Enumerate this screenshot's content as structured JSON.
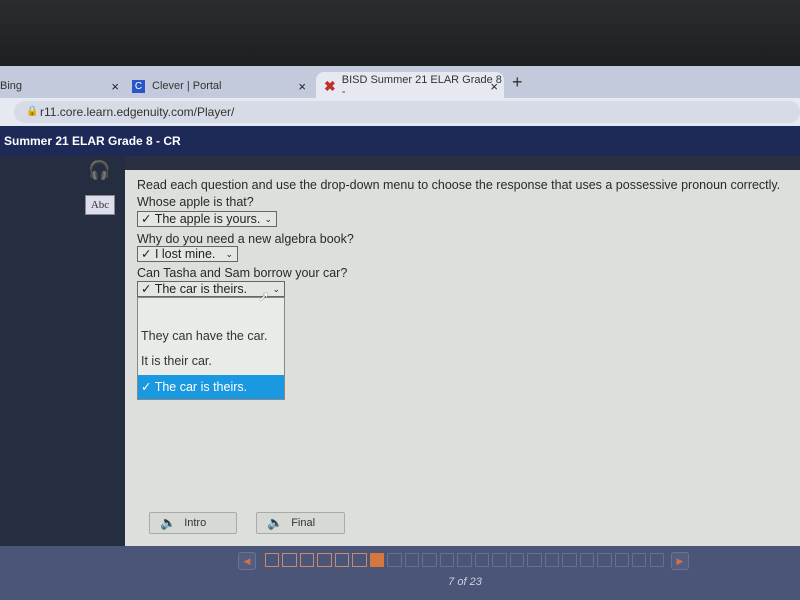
{
  "browser": {
    "tabs": [
      {
        "label": "Bing",
        "icon": "none"
      },
      {
        "label": "Clever | Portal",
        "icon": "clever-icon"
      },
      {
        "label": "BISD Summer 21 ELAR Grade 8 -",
        "icon": "edgenuity-x-icon",
        "active": true
      }
    ],
    "clever_glyph": "C",
    "close_glyph": "×",
    "new_tab_glyph": "+",
    "url": "r11.core.learn.edgenuity.com/Player/"
  },
  "header": {
    "title": "Summer 21 ELAR Grade 8 - CR"
  },
  "tools": {
    "abc_label": "Abc"
  },
  "activity": {
    "instructions": "Read each question and use the drop-down menu to choose the response that uses a possessive pronoun correctly.",
    "questions": [
      {
        "prompt": "Whose apple is that?",
        "answer": "✓ The apple is yours."
      },
      {
        "prompt": "Why do you need a new algebra book?",
        "answer": "✓ I lost mine."
      },
      {
        "prompt": "Can Tasha and Sam borrow your car?",
        "answer": "✓ The car is theirs."
      }
    ],
    "open_dropdown_options": [
      "",
      "They can have the car.",
      "It is their car.",
      "✓ The car is theirs."
    ],
    "selected_option_color": "#1a98e0"
  },
  "audio_buttons": {
    "intro": "Intro",
    "final": "Final"
  },
  "pager": {
    "current": 7,
    "total": 23,
    "label": "7 of 23",
    "current_color": "#d6773e"
  }
}
